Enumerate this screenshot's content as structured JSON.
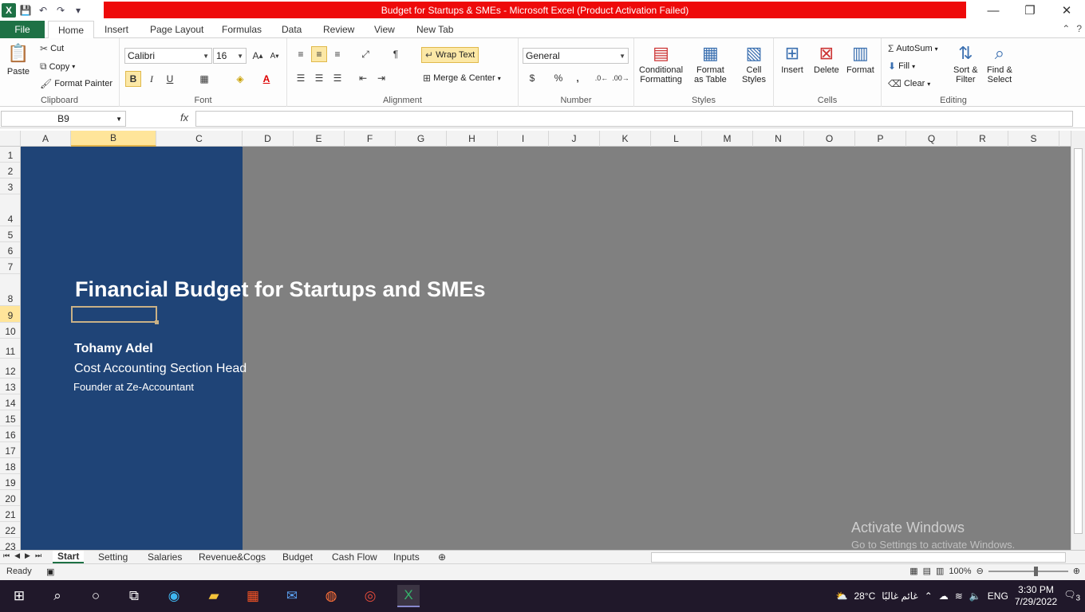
{
  "window": {
    "title": "Budget for Startups & SMEs  -  Microsoft Excel (Product Activation Failed)",
    "controls": {
      "minimize": "—",
      "restore": "❐",
      "close": "✕"
    }
  },
  "menu": {
    "file": "File",
    "tabs": [
      "Home",
      "Insert",
      "Page Layout",
      "Formulas",
      "Data",
      "Review",
      "View",
      "New Tab"
    ]
  },
  "ribbon": {
    "clipboard": {
      "label": "Clipboard",
      "paste": "Paste",
      "cut": "Cut",
      "copy": "Copy",
      "format_painter": "Format Painter"
    },
    "font": {
      "label": "Font",
      "font_name": "Calibri",
      "font_size": "16"
    },
    "alignment": {
      "label": "Alignment",
      "wrap_text": "Wrap Text",
      "merge_center": "Merge & Center"
    },
    "number": {
      "label": "Number",
      "format": "General"
    },
    "styles": {
      "label": "Styles",
      "conditional": "Conditional",
      "conditional2": "Formatting",
      "format_table": "Format",
      "format_table2": "as Table",
      "cell_styles": "Cell",
      "cell_styles2": "Styles"
    },
    "cells": {
      "label": "Cells",
      "insert": "Insert",
      "delete": "Delete",
      "format": "Format"
    },
    "editing": {
      "label": "Editing",
      "autosum": "AutoSum",
      "fill": "Fill",
      "clear": "Clear",
      "sort": "Sort &",
      "sort2": "Filter",
      "find": "Find &",
      "find2": "Select"
    }
  },
  "formula_bar": {
    "name_box": "B9",
    "fx": "fx",
    "value": ""
  },
  "grid": {
    "columns": [
      "A",
      "B",
      "C",
      "D",
      "E",
      "F",
      "G",
      "H",
      "I",
      "J",
      "K",
      "L",
      "M",
      "N",
      "O",
      "P",
      "Q",
      "R",
      "S"
    ],
    "selected_column": "B",
    "rows": [
      "1",
      "2",
      "3",
      "4",
      "5",
      "6",
      "7",
      "8",
      "9",
      "10",
      "11",
      "12",
      "13",
      "14",
      "15",
      "16",
      "17",
      "18",
      "19",
      "20",
      "21",
      "22",
      "23"
    ],
    "selected_row": "9",
    "colors": {
      "blue_panel": "#1f4477",
      "gray_area": "#808080"
    }
  },
  "content": {
    "title": "Financial Budget for Startups and SMEs",
    "author": "Tohamy Adel",
    "role": "Cost Accounting Section Head",
    "company": "Founder at Ze-Accountant"
  },
  "watermark": {
    "line1": "Activate Windows",
    "line2": "Go to Settings to activate Windows."
  },
  "sheets": [
    "Start",
    "Setting",
    "Salaries",
    "Revenue&Cogs",
    "Budget",
    "Cash Flow",
    "Inputs"
  ],
  "active_sheet": "Start",
  "status": {
    "ready": "Ready",
    "zoom": "100%"
  },
  "taskbar": {
    "weather": "28°C",
    "weather_text": "غائم غالبًا",
    "lang": "ENG",
    "time": "3:30 PM",
    "date": "7/29/2022",
    "notifications": "3"
  }
}
